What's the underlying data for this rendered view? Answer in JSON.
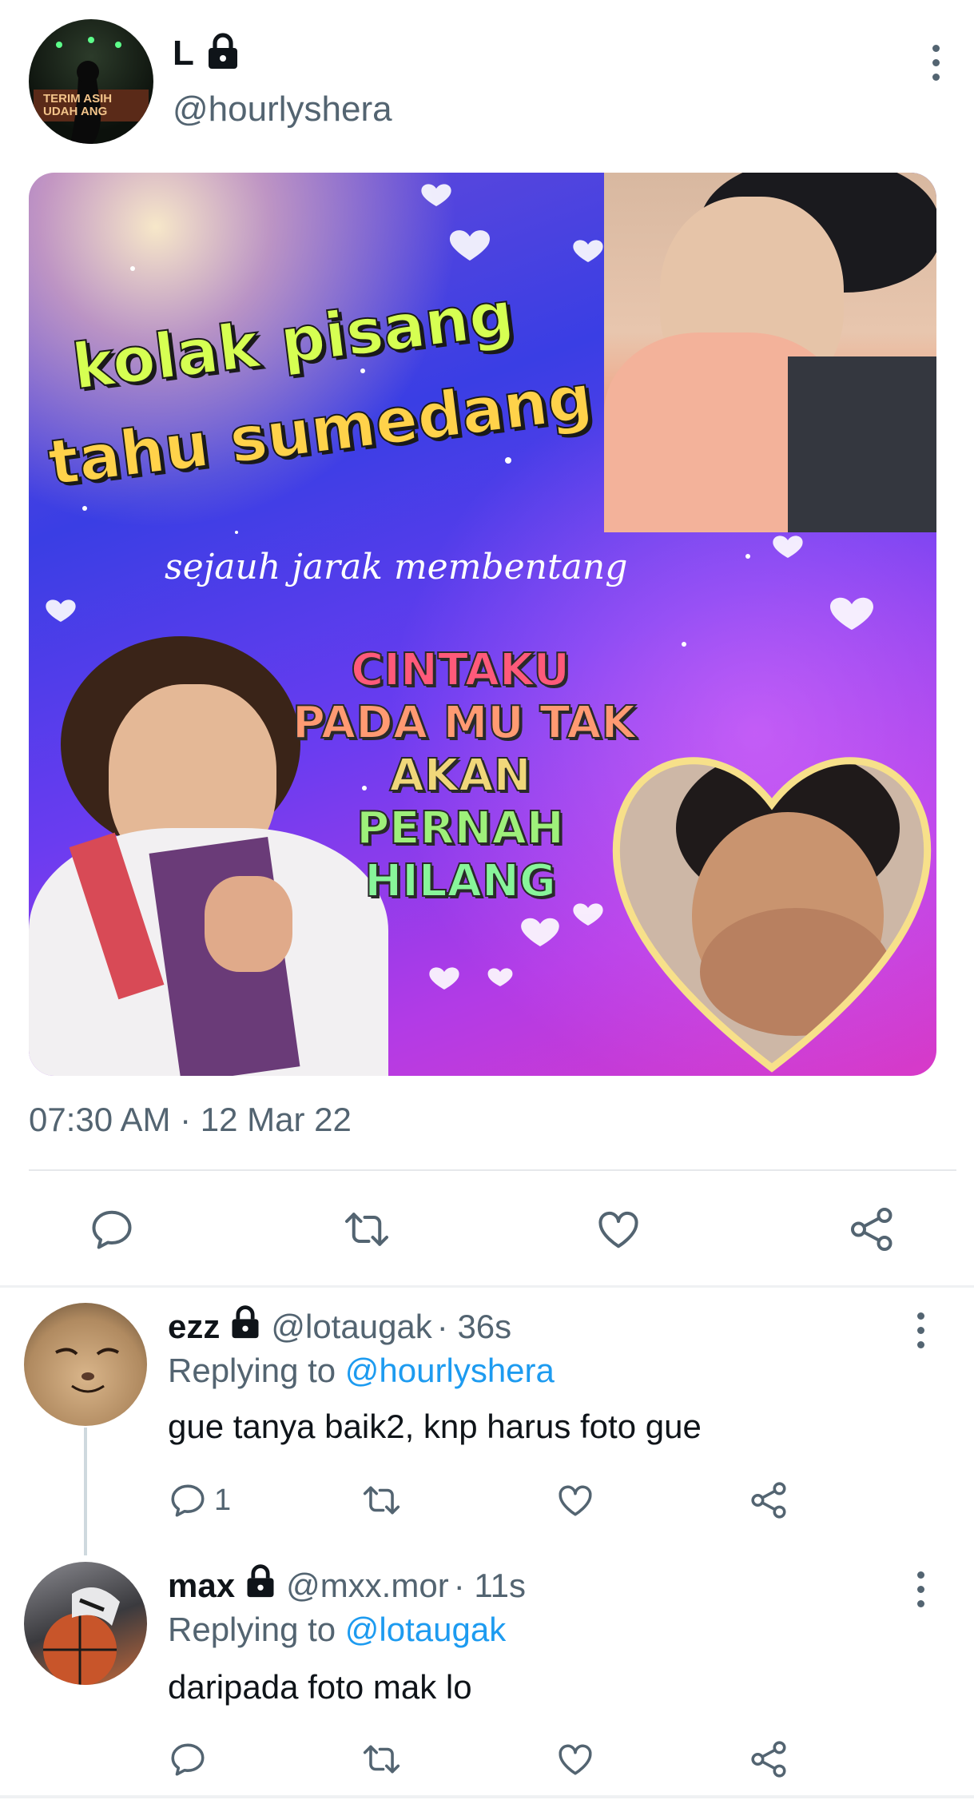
{
  "tweet": {
    "display_name": "L",
    "handle": "@hourlyshera",
    "timestamp": "07:30 AM · 12 Mar 22",
    "avatar_text": [
      "TERIM   ASIH",
      "UDAH     ANG"
    ],
    "image_text": {
      "headline_1": "kolak pisang",
      "headline_2": "tahu sumedang",
      "script_line": "sejauh jarak membentang",
      "lines": [
        "CINTAKU",
        "PADA MU TAK",
        "AKAN",
        "PERNAH",
        "HILANG"
      ]
    },
    "actions": [
      {
        "icon": "reply-icon"
      },
      {
        "icon": "retweet-icon"
      },
      {
        "icon": "like-icon"
      },
      {
        "icon": "share-icon"
      }
    ]
  },
  "replies": [
    {
      "name": "ezz",
      "handle": "@lotaugak",
      "time": "· 36s",
      "replying_label": "Replying to",
      "replying_to": "@hourlyshera",
      "text": "gue tanya baik2, knp harus foto gue",
      "reply_count": "1"
    },
    {
      "name": "max",
      "handle": "@mxx.mor",
      "time": "· 11s",
      "replying_label": "Replying to",
      "replying_to": "@lotaugak",
      "text": "daripada foto mak lo",
      "reply_count": ""
    }
  ],
  "colors": {
    "link": "#1d9bf0",
    "secondary_text": "#536471",
    "divider": "#e6e8eb"
  }
}
